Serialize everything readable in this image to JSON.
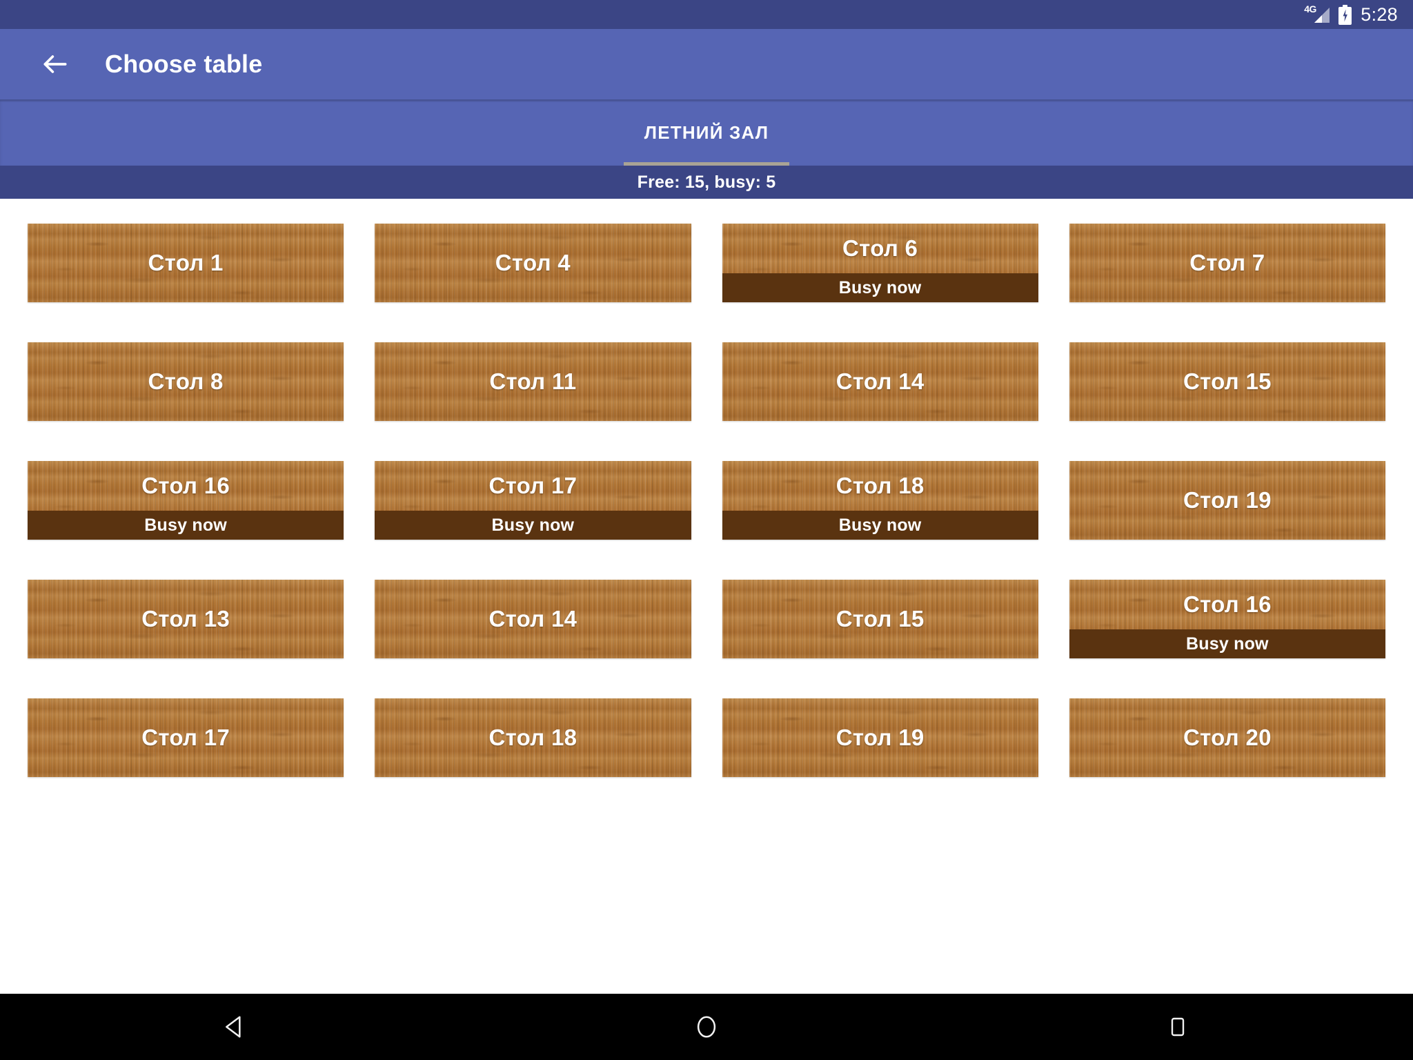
{
  "status_bar": {
    "network_label": "4G",
    "time": "5:28",
    "icons": [
      "signal-icon",
      "battery-charging-icon"
    ],
    "background_color": "#3b4585"
  },
  "app_bar": {
    "back_icon": "arrow-left-icon",
    "title": "Choose table",
    "background_color": "#5665b4"
  },
  "tabs": {
    "items": [
      {
        "label": "ЛЕТНИЙ ЗАЛ",
        "selected": true
      }
    ],
    "indicator_color": "#a9a395"
  },
  "info_bar": {
    "text": "Free: 15, busy: 5",
    "free_count": 15,
    "busy_count": 5,
    "background_color": "#3b4585"
  },
  "busy_label": "Busy now",
  "tables": [
    {
      "name": "Стол 1",
      "busy": false
    },
    {
      "name": "Стол 4",
      "busy": false
    },
    {
      "name": "Стол 6",
      "busy": true
    },
    {
      "name": "Стол 7",
      "busy": false
    },
    {
      "name": "Стол 8",
      "busy": false
    },
    {
      "name": "Стол 11",
      "busy": false
    },
    {
      "name": "Стол 14",
      "busy": false
    },
    {
      "name": "Стол 15",
      "busy": false
    },
    {
      "name": "Стол 16",
      "busy": true
    },
    {
      "name": "Стол 17",
      "busy": true
    },
    {
      "name": "Стол 18",
      "busy": true
    },
    {
      "name": "Стол 19",
      "busy": false
    },
    {
      "name": "Стол 13",
      "busy": false
    },
    {
      "name": "Стол 14",
      "busy": false
    },
    {
      "name": "Стол 15",
      "busy": false
    },
    {
      "name": "Стол 16",
      "busy": true
    },
    {
      "name": "Стол 17",
      "busy": false
    },
    {
      "name": "Стол 18",
      "busy": false
    },
    {
      "name": "Стол 19",
      "busy": false
    },
    {
      "name": "Стол 20",
      "busy": false
    }
  ],
  "nav_bar": {
    "buttons": [
      {
        "icon": "back-triangle-icon"
      },
      {
        "icon": "home-circle-icon"
      },
      {
        "icon": "recents-square-icon"
      }
    ],
    "background_color": "#000000"
  },
  "colors": {
    "wood": "#b07535",
    "busy_band": "#5a3310",
    "primary": "#5665b4",
    "primary_dark": "#3b4585"
  }
}
